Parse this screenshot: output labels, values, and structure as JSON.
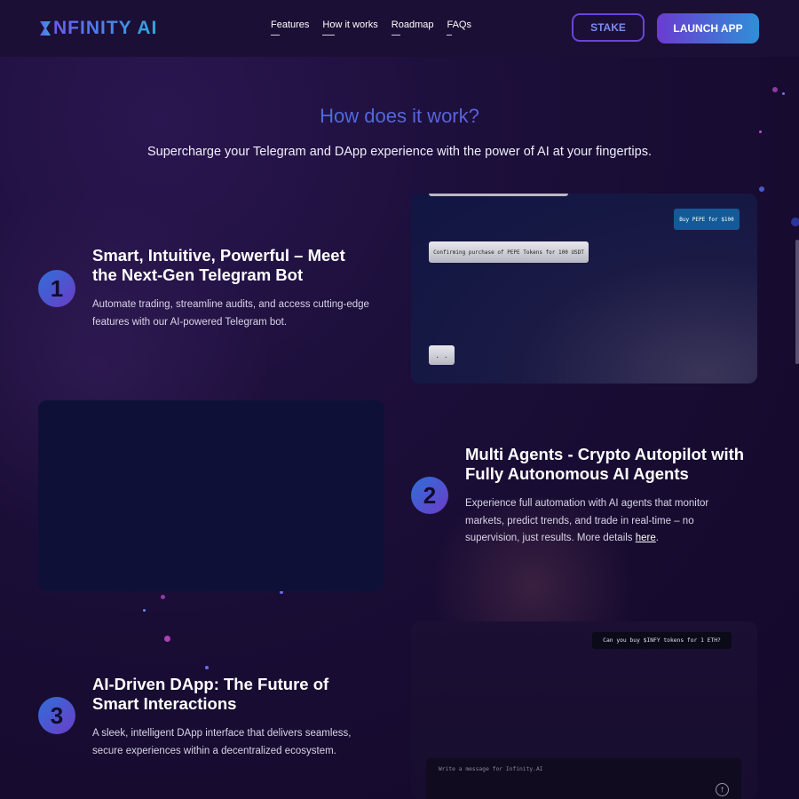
{
  "brand": {
    "name": "NFINITY AI",
    "gradient": [
      "#6a5cf0",
      "#2ea8e0"
    ]
  },
  "nav": {
    "items": [
      "Features",
      "How it works",
      "Roadmap",
      "FAQs"
    ]
  },
  "actions": {
    "stake": "STAKE",
    "launch": "LAUNCH APP"
  },
  "section": {
    "title": "How does it work?",
    "subtitle": "Supercharge your Telegram and DApp experience with the power of AI at your fingertips."
  },
  "steps": [
    {
      "number": "1",
      "title": "Smart, Intuitive, Powerful – Meet the Next-Gen Telegram Bot",
      "desc": "Automate trading, streamline audits, and access cutting-edge features with our AI-powered Telegram bot."
    },
    {
      "number": "2",
      "title": "Multi Agents - Crypto Autopilot with Fully Autonomous AI Agents",
      "desc": "Experience full automation with AI agents that monitor markets, predict trends, and trade in real-time – no supervision, just results. More details ",
      "link": "here",
      "desc_end": "."
    },
    {
      "number": "3",
      "title": "AI-Driven DApp: The Future of Smart Interactions",
      "desc": "A sleek, intelligent DApp interface that delivers seamless, secure experiences within a decentralized ecosystem."
    }
  ],
  "chat1": {
    "user_msg": "Buy PEPE for $100",
    "bot_msg": "Confirming purchase of PEPE Tokens for 100 USDT",
    "typing": ". ."
  },
  "chat3": {
    "user_msg": "Can you buy $INFY tokens for 1 ETH?",
    "input_placeholder": "Write a message for Infinity.AI",
    "send_icon": "arrow-up-icon"
  },
  "colors": {
    "accent": "#6b3bd0",
    "accent2": "#2f8fd8",
    "bg": "#170b30"
  }
}
